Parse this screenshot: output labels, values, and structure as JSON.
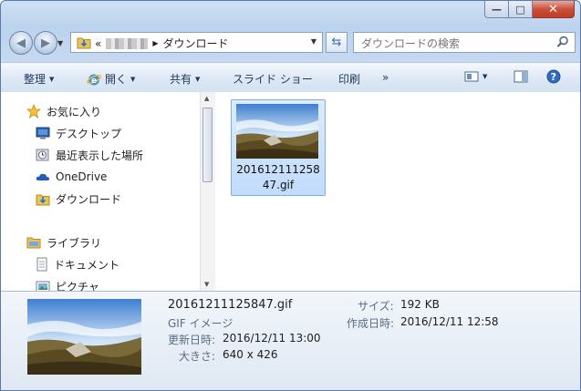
{
  "window": {
    "minimize_glyph": "—",
    "maximize_glyph": "□",
    "close_glyph": "✕"
  },
  "navbar": {
    "breadcrumb_sep": "«",
    "current_folder": "ダウンロード",
    "search_placeholder": "ダウンロードの検索"
  },
  "toolbar": {
    "organize": "整理",
    "open": "開く",
    "share": "共有",
    "slideshow": "スライド ショー",
    "print": "印刷",
    "more": "»"
  },
  "sidebar": {
    "favorites": "お気に入り",
    "desktop": "デスクトップ",
    "recent": "最近表示した場所",
    "onedrive": "OneDrive",
    "downloads": "ダウンロード",
    "libraries": "ライブラリ",
    "documents": "ドキュメント",
    "pictures": "ピクチャ"
  },
  "files": [
    {
      "name": "20161211125847.gif"
    }
  ],
  "details": {
    "filename": "20161211125847.gif",
    "type": "GIF イメージ",
    "modified_label": "更新日時:",
    "modified_value": "2016/12/11 13:00",
    "dimensions_label": "大きさ:",
    "dimensions_value": "640 x 426",
    "size_label": "サイズ:",
    "size_value": "192 KB",
    "created_label": "作成日時:",
    "created_value": "2016/12/11 12:58"
  },
  "colors": {
    "window_frame": "#bcd3ee",
    "selection": "#cce0fb",
    "accent": "#3a6fb6"
  }
}
